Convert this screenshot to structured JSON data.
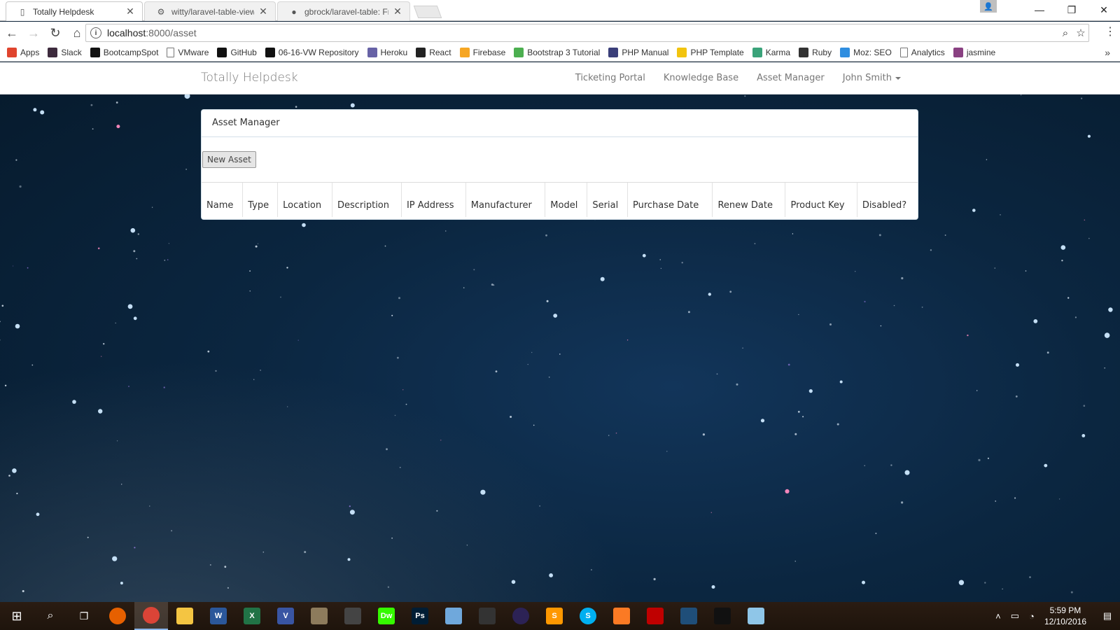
{
  "browser": {
    "tabs": [
      {
        "title": "Totally Helpdesk",
        "icon": "page-icon",
        "active": true
      },
      {
        "title": "witty/laravel-table-view",
        "icon": "packagist-icon",
        "active": false
      },
      {
        "title": "gbrock/laravel-table: Frie",
        "icon": "github-icon",
        "active": false
      }
    ],
    "close_glyph": "✕",
    "url_host": "localhost",
    "url_path": ":8000/asset",
    "bookmarks": [
      {
        "label": "Apps",
        "icon": "apps-icon",
        "color": "#e0442e"
      },
      {
        "label": "Slack",
        "icon": "slack-icon",
        "color": "#3d2b3d"
      },
      {
        "label": "BootcampSpot",
        "icon": "bootcampspot-icon",
        "color": "#111111"
      },
      {
        "label": "VMware",
        "icon": "page-icon",
        "color": "#ffffff"
      },
      {
        "label": "GitHub",
        "icon": "github-icon",
        "color": "#111111"
      },
      {
        "label": "06-16-VW Repository",
        "icon": "github-icon",
        "color": "#111111"
      },
      {
        "label": "Heroku",
        "icon": "heroku-icon",
        "color": "#6762a6"
      },
      {
        "label": "React",
        "icon": "react-icon",
        "color": "#222222"
      },
      {
        "label": "Firebase",
        "icon": "firebase-icon",
        "color": "#f6a623"
      },
      {
        "label": "Bootstrap 3 Tutorial",
        "icon": "w3-icon",
        "color": "#4caf50"
      },
      {
        "label": "PHP Manual",
        "icon": "php-icon",
        "color": "#3b3f7a"
      },
      {
        "label": "PHP Template",
        "icon": "bulb-icon",
        "color": "#f2c40f"
      },
      {
        "label": "Karma",
        "icon": "karma-icon",
        "color": "#3aa37a"
      },
      {
        "label": "Ruby",
        "icon": "ruby-icon",
        "color": "#333333"
      },
      {
        "label": "Moz: SEO",
        "icon": "moz-icon",
        "color": "#2f8ee0"
      },
      {
        "label": "Analytics",
        "icon": "page-icon",
        "color": "#ffffff"
      },
      {
        "label": "jasmine",
        "icon": "jasmine-icon",
        "color": "#8a4182"
      }
    ]
  },
  "navbar": {
    "brand": "Totally Helpdesk",
    "links": [
      "Ticketing Portal",
      "Knowledge Base",
      "Asset Manager"
    ],
    "user": "John Smith"
  },
  "panel": {
    "heading": "Asset Manager",
    "new_button": "New Asset",
    "columns": [
      "Name",
      "Type",
      "Location",
      "Description",
      "IP Address",
      "Manufacturer",
      "Model",
      "Serial",
      "Purchase Date",
      "Renew Date",
      "Product Key",
      "Disabled?"
    ]
  },
  "taskbar": {
    "apps": [
      {
        "name": "firefox-icon",
        "label": "",
        "color": "#e66000"
      },
      {
        "name": "chrome-icon",
        "label": "",
        "color": "#db4437"
      },
      {
        "name": "file-explorer-icon",
        "label": "",
        "color": "#f4c542"
      },
      {
        "name": "word-icon",
        "label": "W",
        "color": "#2b579a"
      },
      {
        "name": "excel-icon",
        "label": "X",
        "color": "#217346"
      },
      {
        "name": "visio-icon",
        "label": "V",
        "color": "#3955a3"
      },
      {
        "name": "gimp-icon",
        "label": "",
        "color": "#8d7b5c"
      },
      {
        "name": "calculator-icon",
        "label": "",
        "color": "#444444"
      },
      {
        "name": "dreamweaver-icon",
        "label": "Dw",
        "color": "#35fa00"
      },
      {
        "name": "photoshop-icon",
        "label": "Ps",
        "color": "#001d34"
      },
      {
        "name": "paint-icon",
        "label": "",
        "color": "#6fa8dc"
      },
      {
        "name": "inkscape-icon",
        "label": "",
        "color": "#333333"
      },
      {
        "name": "eclipse-icon",
        "label": "",
        "color": "#2c2255"
      },
      {
        "name": "sublime-icon",
        "label": "S",
        "color": "#ff9800"
      },
      {
        "name": "skype-icon",
        "label": "S",
        "color": "#00aff0"
      },
      {
        "name": "xampp-icon",
        "label": "",
        "color": "#fb7a24"
      },
      {
        "name": "filezilla-icon",
        "label": "",
        "color": "#bf0000"
      },
      {
        "name": "mysql-workbench-icon",
        "label": "",
        "color": "#1f4e79"
      },
      {
        "name": "terminal-icon",
        "label": "",
        "color": "#111111"
      },
      {
        "name": "notepad-icon",
        "label": "",
        "color": "#8fc6e8"
      }
    ],
    "time": "5:59 PM",
    "date": "12/10/2016"
  }
}
